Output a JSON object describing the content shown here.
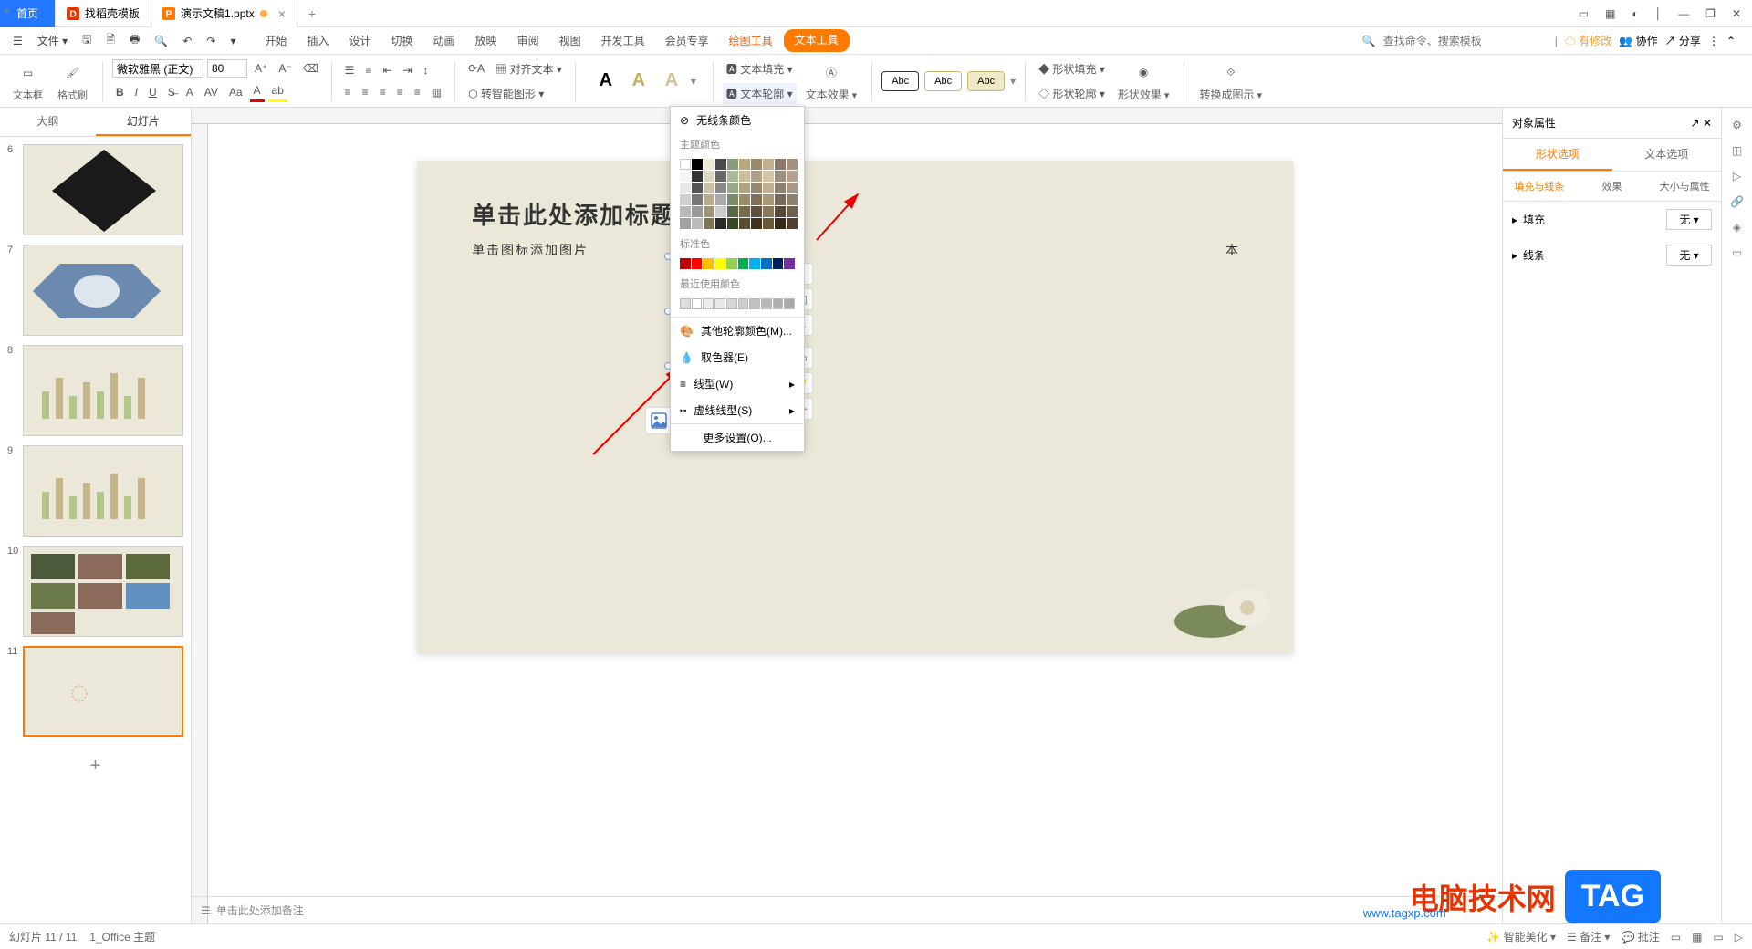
{
  "tabs": {
    "home": "首页",
    "template": "找稻壳模板",
    "doc": "演示文稿1.pptx"
  },
  "menu": {
    "file": "文件",
    "start": "开始",
    "insert": "插入",
    "design": "设计",
    "trans": "切换",
    "anim": "动画",
    "show": "放映",
    "review": "审阅",
    "view": "视图",
    "dev": "开发工具",
    "vip": "会员专享",
    "draw": "绘图工具",
    "text": "文本工具"
  },
  "search": {
    "placeholder": "查找命令、搜索模板"
  },
  "qr": {
    "modify": "有修改",
    "coop": "协作",
    "share": "分享"
  },
  "ribbon": {
    "textbox": "文本框",
    "painter": "格式刷",
    "font": "微软雅黑 (正文)",
    "size": "80",
    "align": "对齐文本",
    "smart": "转智能图形",
    "textfill": "文本填充",
    "textoutline": "文本轮廓",
    "texteffect": "文本效果",
    "shapefill": "形状填充",
    "shapeoutline": "形状轮廓",
    "shapeeffect": "形状效果",
    "toicon": "转换成图示",
    "abc": "Abc"
  },
  "dd": {
    "noline": "无线条颜色",
    "theme": "主题颜色",
    "standard": "标准色",
    "recent": "最近使用颜色",
    "more": "其他轮廓颜色(M)...",
    "eyedrop": "取色器(E)",
    "linetype": "线型(W)",
    "dash": "虚线线型(S)",
    "moreopt": "更多设置(O)..."
  },
  "panel": {
    "outline": "大纲",
    "slides": "幻灯片"
  },
  "slide": {
    "title": "单击此处添加标题",
    "sub": "单击图标添加图片",
    "hint": "本"
  },
  "notes": {
    "ph": "单击此处添加备注"
  },
  "prop": {
    "title": "对象属性",
    "shapeopt": "形状选项",
    "textopt": "文本选项",
    "fillline": "填充与线条",
    "effect": "效果",
    "sizeprop": "大小与属性",
    "fill": "填充",
    "line": "线条",
    "none": "无"
  },
  "status": {
    "slide": "幻灯片 11 / 11",
    "theme": "1_Office 主题",
    "beautify": "智能美化",
    "notes": "备注",
    "comment": "批注"
  },
  "wm": {
    "text": "电脑技术网",
    "url": "www.tagxp.com",
    "tag": "TAG"
  },
  "thumbs": [
    "6",
    "7",
    "8",
    "9",
    "10",
    "11"
  ]
}
